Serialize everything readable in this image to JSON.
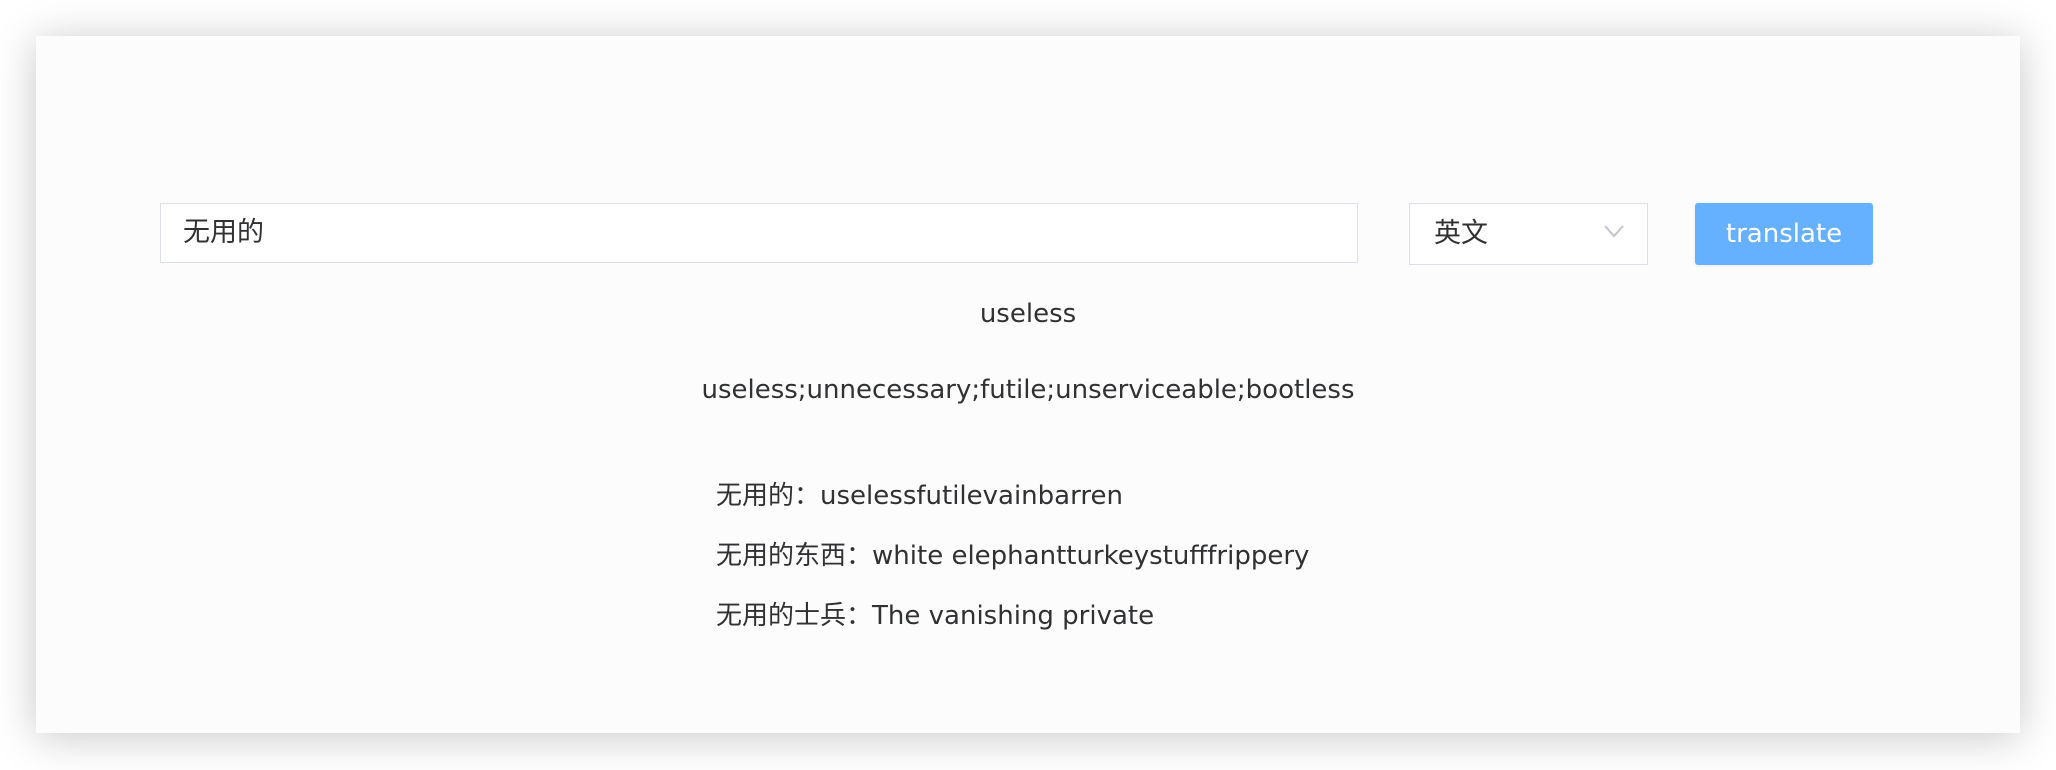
{
  "search": {
    "value": "无用的"
  },
  "language_select": {
    "selected": "英文",
    "icon": "chevron-down-icon"
  },
  "translate_button": {
    "label": "translate",
    "color": "#66b1ff"
  },
  "result": {
    "word": "useless",
    "synonyms": "useless;unnecessary;futile;unserviceable;bootless",
    "phrases": [
      {
        "term": "无用的",
        "separator": "：",
        "meaning": "uselessfutilevainbarren"
      },
      {
        "term": "无用的东西",
        "separator": "：",
        "meaning": "white elephantturkeystufffrippery"
      },
      {
        "term": "无用的士兵",
        "separator": "：",
        "meaning": "The vanishing private"
      }
    ]
  }
}
